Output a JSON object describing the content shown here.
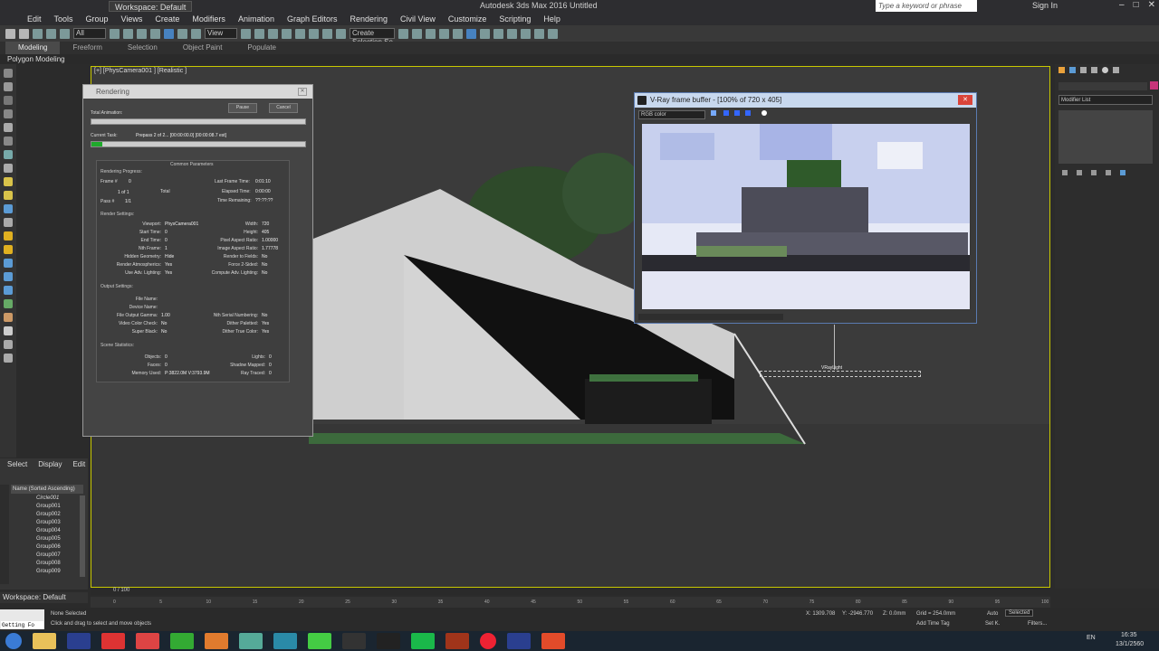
{
  "titlebar": {
    "workspace": "Workspace: Default",
    "title": "Autodesk 3ds Max 2016   Untitled",
    "search_placeholder": "Type a keyword or phrase",
    "signin": "Sign In"
  },
  "menu": [
    "Edit",
    "Tools",
    "Group",
    "Views",
    "Create",
    "Modifiers",
    "Animation",
    "Graph Editors",
    "Rendering",
    "Civil View",
    "Customize",
    "Scripting",
    "Help"
  ],
  "toolbar": {
    "selection_filter": "All",
    "view_dropdown": "View",
    "selection_set": "Create Selection Se"
  },
  "ribbon": {
    "tabs": [
      "Modeling",
      "Freeform",
      "Selection",
      "Object Paint",
      "Populate"
    ],
    "active": "Modeling",
    "subtitle": "Polygon Modeling"
  },
  "viewport": {
    "label": "[+] [PhysCamera001 ] [Realistic ]",
    "object_label": "VRayLight"
  },
  "render_dialog": {
    "title": "Rendering",
    "pause": "Pause",
    "cancel": "Cancel",
    "total_animation": "Total Animation:",
    "current_task_label": "Current Task:",
    "current_task": "Prepass 2 of 2... [00:00:00.0] [00:00:08.7 est]",
    "common_params": "Common Parameters",
    "progress": {
      "section": "Rendering Progress:",
      "frame_label": "Frame #",
      "frame_value": "0",
      "of_value": "1   of   1",
      "total": "Total",
      "pass_label": "Pass #",
      "pass_value": "1/1",
      "last_frame_label": "Last Frame Time:",
      "last_frame_value": "0:01:10",
      "elapsed_label": "Elapsed Time:",
      "elapsed_value": "0:00:00",
      "remaining_label": "Time Remaining:",
      "remaining_value": "??:??:??"
    },
    "render_settings": {
      "section": "Render Settings:",
      "left": [
        [
          "Viewport:",
          "PhysCamera001"
        ],
        [
          "Start Time:",
          "0"
        ],
        [
          "End Time:",
          "0"
        ],
        [
          "Nth Frame:",
          "1"
        ],
        [
          "Hidden Geometry:",
          "Hide"
        ],
        [
          "Render Atmospherics:",
          "Yes"
        ],
        [
          "Use Adv. Lighting:",
          "Yes"
        ]
      ],
      "right": [
        [
          "Width:",
          "720"
        ],
        [
          "Height:",
          "405"
        ],
        [
          "Pixel Aspect Ratio:",
          "1.00000"
        ],
        [
          "Image Aspect Ratio:",
          "1.77778"
        ],
        [
          "Render to Fields:",
          "No"
        ],
        [
          "Force 2-Sided:",
          "No"
        ],
        [
          "Compute Adv. Lighting:",
          "No"
        ]
      ]
    },
    "output_settings": {
      "section": "Output Settings:",
      "left": [
        [
          "File Name:",
          ""
        ],
        [
          "Device Name:",
          ""
        ],
        [
          "File Output Gamma:",
          "1.00"
        ],
        [
          "Video Color Check:",
          "No"
        ],
        [
          "Super Black:",
          "No"
        ]
      ],
      "right": [
        [
          "Nth Serial Numbering:",
          "No"
        ],
        [
          "Dither Paletted:",
          "Yes"
        ],
        [
          "Dither True Color:",
          "Yes"
        ]
      ]
    },
    "scene_stats": {
      "section": "Scene Statistics:",
      "left": [
        [
          "Objects:",
          "0"
        ],
        [
          "Faces:",
          "0"
        ],
        [
          "Memory Used:",
          "P:3822.0M V:3793.9M"
        ]
      ],
      "right": [
        [
          "Lights:",
          "0"
        ],
        [
          "Shadow Mapped:",
          "0"
        ],
        [
          "Ray Traced:",
          "0"
        ]
      ]
    }
  },
  "vray": {
    "title": "V-Ray frame buffer - [100% of 720 x 405]",
    "channel": "RGB color"
  },
  "command_panel": {
    "modifier_list": "Modifier List"
  },
  "scene_explorer": {
    "tabs": [
      "Select",
      "Display",
      "Edit"
    ],
    "column": "Name (Sorted Ascending)",
    "rows": [
      "Circle001",
      "Group001",
      "Group002",
      "Group003",
      "Group004",
      "Group005",
      "Group006",
      "Group007",
      "Group008",
      "Group009"
    ],
    "workspace": "Workspace: Default"
  },
  "timeline": {
    "frame": "0 / 100",
    "ticks": [
      "0",
      "5",
      "10",
      "15",
      "20",
      "25",
      "30",
      "35",
      "40",
      "45",
      "50",
      "55",
      "60",
      "65",
      "70",
      "75",
      "80",
      "85",
      "90",
      "95",
      "100"
    ]
  },
  "status": {
    "maxscript": "Getting Fo",
    "none_selected": "None Selected",
    "prompt": "Click and drag to select and move objects",
    "x": "X: 1309.708",
    "y": "Y: -2946.770",
    "z": "Z: 0.0mm",
    "grid": "Grid = 254.0mm",
    "add_time_tag": "Add Time Tag",
    "auto": "Auto",
    "selected": "Selected",
    "setk": "Set K.",
    "filters": "Filters..."
  },
  "taskbar": {
    "lang": "EN",
    "time": "16:35",
    "date": "13/1/2560"
  }
}
